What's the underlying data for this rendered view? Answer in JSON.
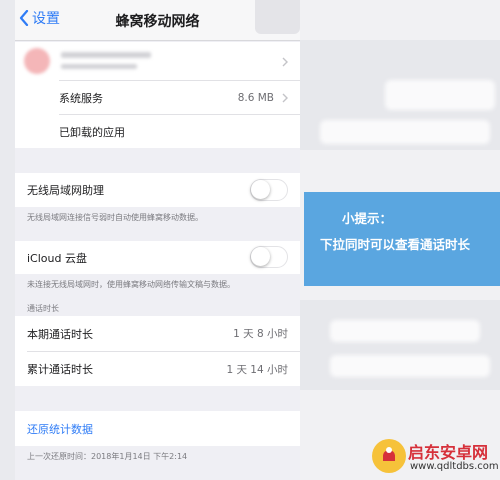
{
  "nav": {
    "back_label": "设置",
    "title": "蜂窝移动网络"
  },
  "rows": {
    "system_services": {
      "label": "系统服务",
      "value": "8.6 MB"
    },
    "uninstalled_apps": {
      "label": "已卸载的应用"
    },
    "wifi_assist": {
      "label": "无线局域网助理",
      "footer": "无线局域网连接信号弱时自动使用蜂窝移动数据。",
      "enabled": false
    },
    "icloud_drive": {
      "label": "iCloud 云盘",
      "footer": "未连接无线局域网时，使用蜂窝移动网络传输文稿与数据。",
      "enabled": false
    },
    "call_time_header": "通话时长",
    "current_period": {
      "label": "本期通话时长",
      "value": "1 天 8 小时"
    },
    "lifetime": {
      "label": "累计通话时长",
      "value": "1 天 14 小时"
    },
    "reset": {
      "label": "还原统计数据",
      "footer": "上一次还原时间：2018年1月14日 下午2:14"
    }
  },
  "tip": {
    "title": "小提示：",
    "text": "下拉同时可以查看通话时长"
  },
  "watermark": {
    "name": "启东安卓网",
    "url": "www.qdltdbs.com"
  },
  "colors": {
    "accent": "#2f7cf6",
    "tip_bg": "#5aa6e0",
    "background": "#efeff4"
  }
}
